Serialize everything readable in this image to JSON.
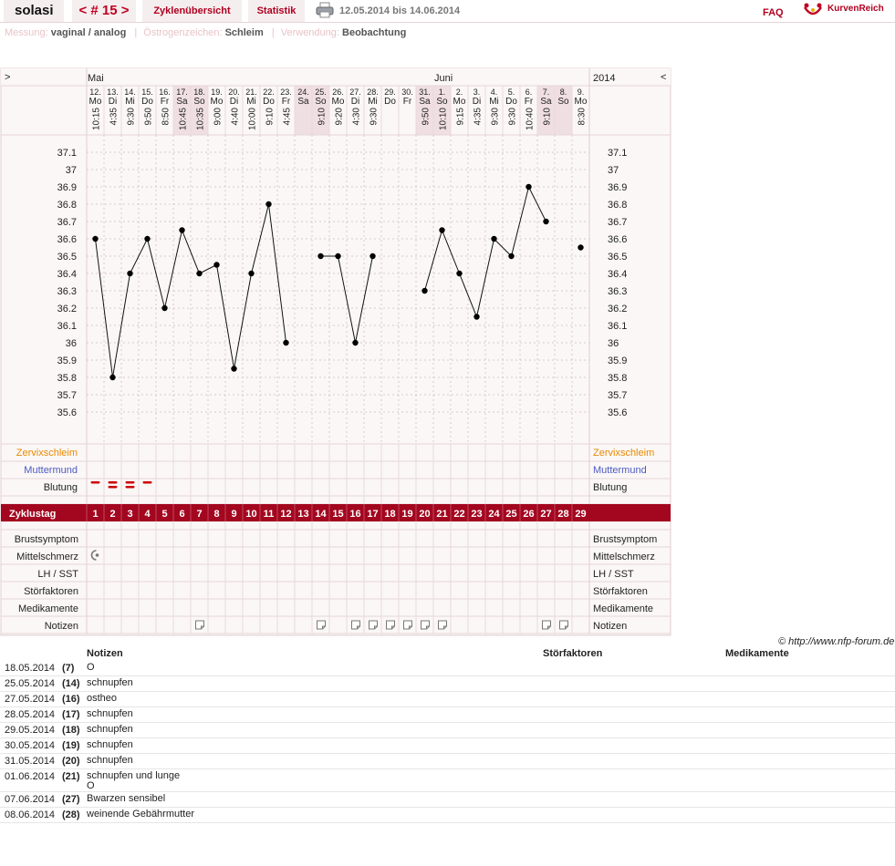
{
  "header": {
    "brand": "solasi",
    "cycle_label": "< # 15 >",
    "tab_overview": "Zyklenübersicht",
    "tab_stats": "Statistik",
    "date_range": "12.05.2014 bis 14.06.2014",
    "faq": "FAQ",
    "logo_text": "KurvenReich"
  },
  "info": {
    "measure_label": "Messung:",
    "measure_value": "vaginal / analog",
    "estrogen_label": "Östrogenzeichen:",
    "estrogen_value": "Schleim",
    "usage_label": "Verwendung:",
    "usage_value": "Beobachtung"
  },
  "chart_nav": {
    "left_arrow": ">",
    "right_arrow": "<",
    "year": "2014"
  },
  "months": [
    {
      "name": "Mai",
      "start_index": 0
    },
    {
      "name": "Juni",
      "start_index": 20
    }
  ],
  "colors": {
    "accent": "#a3061f",
    "weekend": "#f0dfe2",
    "cervix": "#e88a00",
    "mouth": "#4a5ac0",
    "blood": "#cc0000"
  },
  "days": [
    {
      "date": "12.",
      "wd": "Mo",
      "time": "10:15",
      "weekend": false
    },
    {
      "date": "13.",
      "wd": "Di",
      "time": "4:35",
      "weekend": false
    },
    {
      "date": "14.",
      "wd": "Mi",
      "time": "9:30",
      "weekend": false
    },
    {
      "date": "15.",
      "wd": "Do",
      "time": "9:50",
      "weekend": false
    },
    {
      "date": "16.",
      "wd": "Fr",
      "time": "8:50",
      "weekend": false
    },
    {
      "date": "17.",
      "wd": "Sa",
      "time": "10:45",
      "weekend": true
    },
    {
      "date": "18.",
      "wd": "So",
      "time": "10:35",
      "weekend": true
    },
    {
      "date": "19.",
      "wd": "Mo",
      "time": "9:00",
      "weekend": false
    },
    {
      "date": "20.",
      "wd": "Di",
      "time": "4:40",
      "weekend": false
    },
    {
      "date": "21.",
      "wd": "Mi",
      "time": "10:00",
      "weekend": false
    },
    {
      "date": "22.",
      "wd": "Do",
      "time": "9:10",
      "weekend": false
    },
    {
      "date": "23.",
      "wd": "Fr",
      "time": "4:45",
      "weekend": false
    },
    {
      "date": "24.",
      "wd": "Sa",
      "time": "",
      "weekend": true
    },
    {
      "date": "25.",
      "wd": "So",
      "time": "9:10",
      "weekend": true
    },
    {
      "date": "26.",
      "wd": "Mo",
      "time": "9:20",
      "weekend": false
    },
    {
      "date": "27.",
      "wd": "Di",
      "time": "4:30",
      "weekend": false
    },
    {
      "date": "28.",
      "wd": "Mi",
      "time": "9:30",
      "weekend": false
    },
    {
      "date": "29.",
      "wd": "Do",
      "time": "",
      "weekend": false
    },
    {
      "date": "30.",
      "wd": "Fr",
      "time": "",
      "weekend": false
    },
    {
      "date": "31.",
      "wd": "Sa",
      "time": "9:50",
      "weekend": true
    },
    {
      "date": "1.",
      "wd": "So",
      "time": "10:10",
      "weekend": true
    },
    {
      "date": "2.",
      "wd": "Mo",
      "time": "9:15",
      "weekend": false
    },
    {
      "date": "3.",
      "wd": "Di",
      "time": "4:35",
      "weekend": false
    },
    {
      "date": "4.",
      "wd": "Mi",
      "time": "9:30",
      "weekend": false
    },
    {
      "date": "5.",
      "wd": "Do",
      "time": "9:30",
      "weekend": false
    },
    {
      "date": "6.",
      "wd": "Fr",
      "time": "10:40",
      "weekend": false
    },
    {
      "date": "7.",
      "wd": "Sa",
      "time": "9:10",
      "weekend": true
    },
    {
      "date": "8.",
      "wd": "So",
      "time": "",
      "weekend": true
    },
    {
      "date": "9.",
      "wd": "Mo",
      "time": "8:30",
      "weekend": false
    }
  ],
  "chart_data": {
    "type": "line",
    "y_ticks": [
      "37.1",
      "37",
      "36.9",
      "36.8",
      "36.7",
      "36.6",
      "36.5",
      "36.4",
      "36.3",
      "36.2",
      "36.1",
      "36",
      "35.9",
      "35.8",
      "35.7",
      "35.6"
    ],
    "ylim": [
      35.6,
      37.1
    ],
    "x": [
      1,
      2,
      3,
      4,
      5,
      6,
      7,
      8,
      9,
      10,
      11,
      12,
      13,
      14,
      15,
      16,
      17,
      18,
      19,
      20,
      21,
      22,
      23,
      24,
      25,
      26,
      27,
      28,
      29
    ],
    "series": [
      {
        "values": [
          36.6,
          35.8,
          36.4,
          36.6,
          36.2,
          36.65,
          36.4,
          36.45,
          35.85,
          36.4,
          36.8,
          36.0,
          null,
          36.5,
          36.5,
          36.0,
          36.5,
          null,
          null,
          36.3,
          36.65,
          36.4,
          36.15,
          36.6,
          36.5,
          36.9,
          36.7,
          null,
          36.55
        ],
        "connected_until": 27
      }
    ],
    "bleeding_days": [
      1,
      2,
      3,
      4
    ],
    "bleeding_strength": [
      1,
      2,
      2,
      1
    ],
    "midpain_days": [
      1
    ],
    "note_days": [
      7,
      14,
      16,
      17,
      18,
      19,
      20,
      21,
      27,
      28
    ]
  },
  "rows": {
    "cervix": "Zervixschleim",
    "mouth": "Muttermund",
    "blood": "Blutung",
    "cycleday": "Zyklustag",
    "breast": "Brustsymptom",
    "midpain": "Mittelschmerz",
    "lh": "LH / SST",
    "disturb": "Störfaktoren",
    "meds": "Medikamente",
    "notes": "Notizen"
  },
  "copyright": "© http://www.nfp-forum.de",
  "notes_table": {
    "col_notes": "Notizen",
    "col_disturb": "Störfaktoren",
    "col_meds": "Medikamente",
    "rows": [
      {
        "date": "18.05.2014",
        "day": "(7)",
        "note": "O"
      },
      {
        "date": "25.05.2014",
        "day": "(14)",
        "note": "schnupfen"
      },
      {
        "date": "27.05.2014",
        "day": "(16)",
        "note": "ostheo"
      },
      {
        "date": "28.05.2014",
        "day": "(17)",
        "note": "schnupfen"
      },
      {
        "date": "29.05.2014",
        "day": "(18)",
        "note": "schnupfen"
      },
      {
        "date": "30.05.2014",
        "day": "(19)",
        "note": "schnupfen"
      },
      {
        "date": "31.05.2014",
        "day": "(20)",
        "note": "schnupfen"
      },
      {
        "date": "01.06.2014",
        "day": "(21)",
        "note": "schnupfen und lunge\nO"
      },
      {
        "date": "07.06.2014",
        "day": "(27)",
        "note": "Bwarzen sensibel"
      },
      {
        "date": "08.06.2014",
        "day": "(28)",
        "note": "weinende Gebährmutter"
      }
    ]
  }
}
